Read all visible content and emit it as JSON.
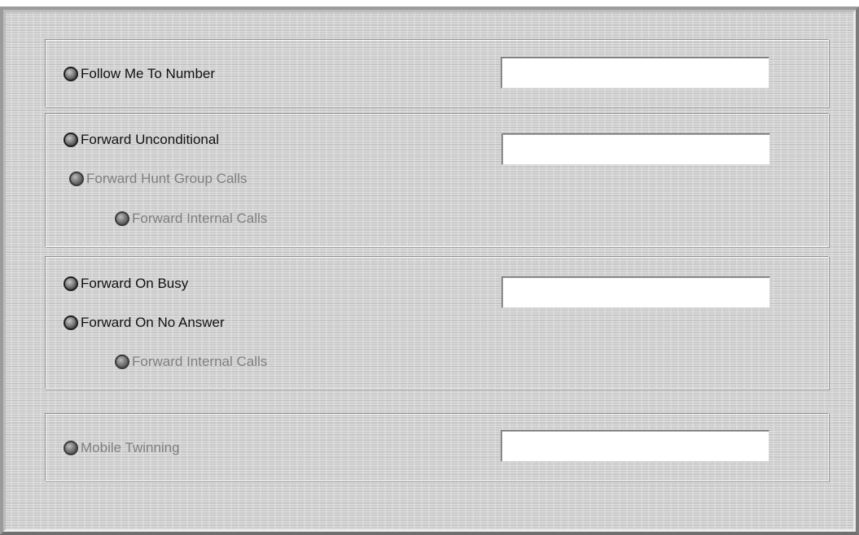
{
  "follow_me": {
    "option_label": "Follow Me To Number",
    "number_value": ""
  },
  "unconditional": {
    "option_label": "Forward Unconditional",
    "hunt_group_label": "Forward Hunt Group Calls",
    "internal_calls_label": "Forward Internal Calls",
    "number_value": ""
  },
  "busy_no_answer": {
    "busy_label": "Forward On Busy",
    "no_answer_label": "Forward On No Answer",
    "internal_calls_label": "Forward Internal Calls",
    "number_value": ""
  },
  "mobile": {
    "option_label": "Mobile Twinning",
    "number_value": ""
  },
  "icons": {
    "radio": "radio-button-icon"
  }
}
